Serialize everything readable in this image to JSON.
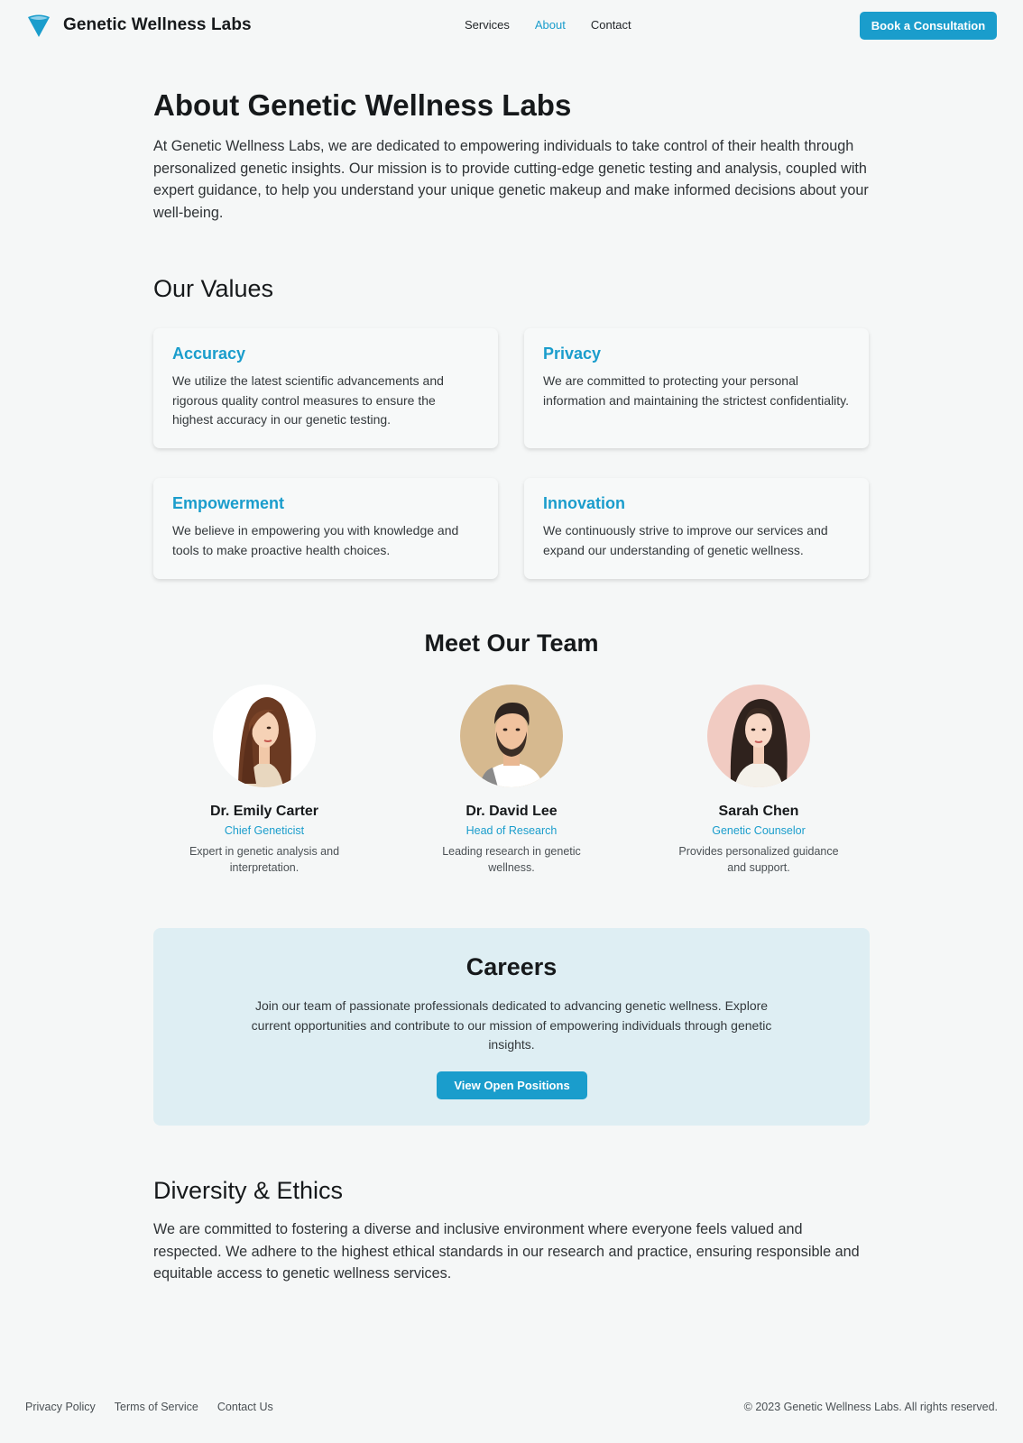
{
  "brand": {
    "name": "Genetic Wellness Labs",
    "logo_icon": "funnel-logo-icon",
    "accent_color": "#1a9dcc"
  },
  "nav": {
    "items": [
      {
        "label": "Services",
        "active": false
      },
      {
        "label": "About",
        "active": true
      },
      {
        "label": "Contact",
        "active": false
      }
    ],
    "cta_label": "Book a Consultation"
  },
  "about": {
    "title": "About Genetic Wellness Labs",
    "intro": "At Genetic Wellness Labs, we are dedicated to empowering individuals to take control of their health through personalized genetic insights. Our mission is to provide cutting-edge genetic testing and analysis, coupled with expert guidance, to help you understand your unique genetic makeup and make informed decisions about your well-being."
  },
  "values": {
    "title": "Our Values",
    "items": [
      {
        "title": "Accuracy",
        "text": "We utilize the latest scientific advancements and rigorous quality control measures to ensure the highest accuracy in our genetic testing."
      },
      {
        "title": "Privacy",
        "text": "We are committed to protecting your personal information and maintaining the strictest confidentiality."
      },
      {
        "title": "Empowerment",
        "text": "We believe in empowering you with knowledge and tools to make proactive health choices."
      },
      {
        "title": "Innovation",
        "text": "We continuously strive to improve our services and expand our understanding of genetic wellness."
      }
    ]
  },
  "team": {
    "title": "Meet Our Team",
    "members": [
      {
        "name": "Dr. Emily Carter",
        "role": "Chief Geneticist",
        "bio": "Expert in genetic analysis and interpretation.",
        "avatar_bg": "#ffffff"
      },
      {
        "name": "Dr. David Lee",
        "role": "Head of Research",
        "bio": "Leading research in genetic wellness.",
        "avatar_bg": "#d6b98f"
      },
      {
        "name": "Sarah Chen",
        "role": "Genetic Counselor",
        "bio": "Provides personalized guidance and support.",
        "avatar_bg": "#f1cbc2"
      }
    ]
  },
  "careers": {
    "title": "Careers",
    "text": "Join our team of passionate professionals dedicated to advancing genetic wellness. Explore current opportunities and contribute to our mission of empowering individuals through genetic insights.",
    "button_label": "View Open Positions"
  },
  "diversity": {
    "title": "Diversity & Ethics",
    "text": "We are committed to fostering a diverse and inclusive environment where everyone feels valued and respected. We adhere to the highest ethical standards in our research and practice, ensuring responsible and equitable access to genetic wellness services."
  },
  "footer": {
    "links": [
      "Privacy Policy",
      "Terms of Service",
      "Contact Us"
    ],
    "copyright": "© 2023 Genetic Wellness Labs. All rights reserved."
  }
}
